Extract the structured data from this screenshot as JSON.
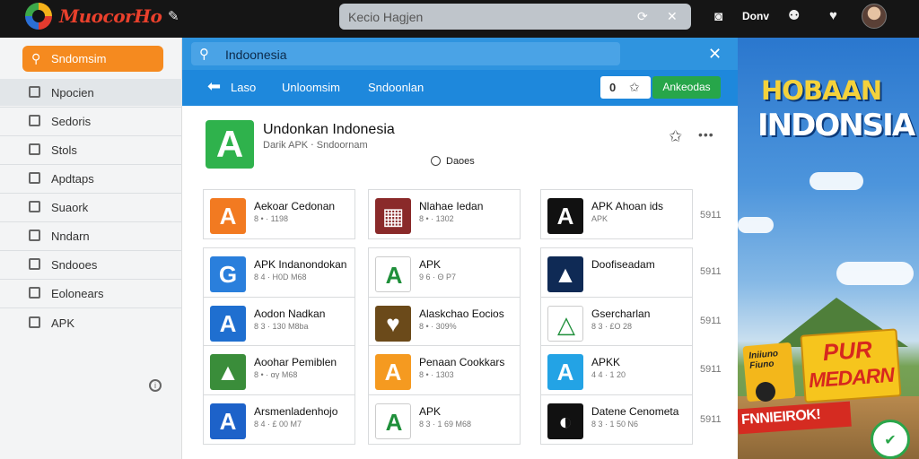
{
  "topbar": {
    "logo_text": "MuocorHo",
    "search_placeholder": "Kecio Hagjen",
    "user_label": "Donv"
  },
  "sidebar": {
    "search_label": "Sndomsim",
    "items": [
      {
        "label": "Npocien",
        "active": true
      },
      {
        "label": "Sedoris"
      },
      {
        "label": "Stols"
      },
      {
        "label": "Apdtaps"
      },
      {
        "label": "Suaork"
      },
      {
        "label": "Nndarn"
      },
      {
        "label": "Sndooes"
      },
      {
        "label": "Eolonears"
      },
      {
        "label": "APK"
      }
    ]
  },
  "main": {
    "search_text": "Indoonesia",
    "nav": {
      "links": [
        "Laso",
        "Unloomsim",
        "Sndoonlan"
      ],
      "box_label": "0",
      "button_label": "Ankeodas"
    },
    "app": {
      "title": "Undonkan Indonesia",
      "subtitle": "Darik APK ‧ Sndoornam",
      "meta": "Daoes"
    },
    "cards": [
      {
        "name": "Aekoar Cedonan",
        "meta": "8 • · 1198",
        "icon_color": "#f27a21",
        "glyph": "A"
      },
      {
        "name": "Nlahae Iedan",
        "meta": "8 • · 1302",
        "icon_color": "#8a2a2a",
        "glyph": "▦"
      },
      {
        "name": "APK Ahoan ids",
        "meta": "APK",
        "icon_color": "#111111",
        "glyph": "A"
      },
      {
        "name": "APK Indanondokan",
        "meta": "8 4 · H0D M68",
        "icon_color": "#2a7fdc",
        "glyph": "G"
      },
      {
        "name": "APK",
        "meta": "9 6 · Θ P7",
        "icon_color": "#ffffff",
        "glyph": "A"
      },
      {
        "name": "Doofiseadam",
        "meta": "",
        "icon_color": "#0f2a55",
        "glyph": "▲"
      },
      {
        "name": "Aodon Nadkan",
        "meta": "8 3 · 130 M8ba",
        "icon_color": "#1f6fd0",
        "glyph": "A"
      },
      {
        "name": "Alaskchao Eocios",
        "meta": "8 • · 309%",
        "icon_color": "#6b4a1a",
        "glyph": "♥"
      },
      {
        "name": "Gsercharlan",
        "meta": "8 3 · £O 28",
        "icon_color": "#ffffff",
        "glyph": "△"
      },
      {
        "name": "Aoohar Pemiblen",
        "meta": "8 • · αγ M68",
        "icon_color": "#3a8d3a",
        "glyph": "▲"
      },
      {
        "name": "Penaan Cookkars",
        "meta": "8 • · 1303",
        "icon_color": "#f59a20",
        "glyph": "A"
      },
      {
        "name": "APKK",
        "meta": "4 4 · 1 20",
        "icon_color": "#23a3e5",
        "glyph": "A"
      },
      {
        "name": "Arsmenladenhojo",
        "meta": "8 4 · £ 00 M7",
        "icon_color": "#1d62c9",
        "glyph": "A"
      },
      {
        "name": "APK",
        "meta": "8 3 · 1 69 M68",
        "icon_color": "#ffffff",
        "glyph": "A"
      },
      {
        "name": "Datene Cenometa",
        "meta": "8 3 · 1 50 N6",
        "icon_color": "#111111",
        "glyph": "◐"
      }
    ],
    "side_numbers": [
      "5911",
      "5911",
      "5911",
      "5911",
      "5911"
    ]
  },
  "banner": {
    "title_line1": "HOBAAN",
    "title_line2": "INDONSIA",
    "small_label": "Iniiuno Fiuno",
    "pur_line1": "PUR",
    "pur_line2": "MEDARN",
    "strip_text": "FNNIEIROK!"
  }
}
